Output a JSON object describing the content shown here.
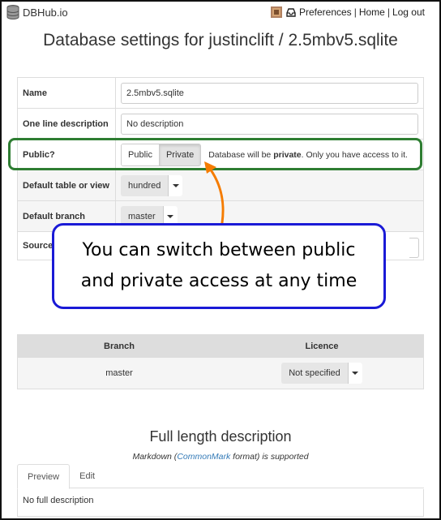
{
  "brand": {
    "name": "DBHub.io"
  },
  "topnav": {
    "preferences": "Preferences",
    "home": "Home",
    "logout": "Log out",
    "separator": "|"
  },
  "title": {
    "prefix": "Database settings for ",
    "path": "justinclift / 2.5mbv5.sqlite"
  },
  "settings": {
    "name_label": "Name",
    "name_value": "2.5mbv5.sqlite",
    "desc_label": "One line description",
    "desc_value": "No description",
    "public_label": "Public?",
    "public_option": "Public",
    "private_option": "Private",
    "privacy_note_prefix": "Database will be ",
    "privacy_note_bold": "private",
    "privacy_note_suffix": ". Only you have access to it.",
    "default_table_label": "Default table or view",
    "default_table_value": "hundred",
    "default_branch_label": "Default branch",
    "default_branch_value": "master",
    "source_label": "Source"
  },
  "callout": {
    "line1": "You can switch between public",
    "line2": "and private access at any time"
  },
  "branches": {
    "col_branch": "Branch",
    "col_licence": "Licence",
    "rows": [
      {
        "branch": "master",
        "licence": "Not specified"
      }
    ]
  },
  "full_desc": {
    "title": "Full length description",
    "note_prefix": "Markdown (",
    "note_link": "CommonMark",
    "note_suffix": " format) is supported",
    "tab_preview": "Preview",
    "tab_edit": "Edit",
    "content": "No full description"
  },
  "colors": {
    "highlight": "#2e7d32",
    "callout_border": "#1a1ad6",
    "arrow": "#f57c00",
    "link": "#337ab7"
  }
}
